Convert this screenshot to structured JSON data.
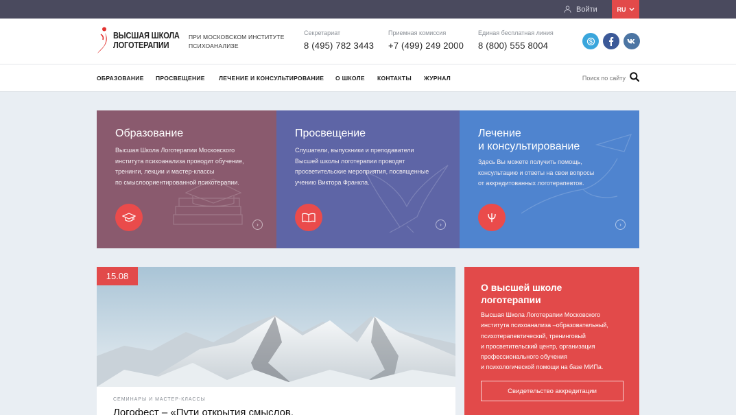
{
  "topbar": {
    "login_label": "Войти",
    "lang_label": "RU"
  },
  "header": {
    "logo_text": "ВЫСШАЯ ШКОЛА ЛОГОТЕРАПИИ",
    "tagline": "ПРИ МОСКОВСКОМ ИНСТИТУТЕ ПСИХОАНАЛИЗЕ",
    "contacts": [
      {
        "label": "Секретариат",
        "number": "8 (495) 782 3443"
      },
      {
        "label": "Приемная комиссия",
        "number": "+7 (499) 249 2000"
      },
      {
        "label": "Единая бесплатная линия",
        "number": "8 (800) 555 8004"
      }
    ],
    "social": [
      {
        "icon": "skype-icon",
        "color": "#3aa6dc"
      },
      {
        "icon": "facebook-icon",
        "color": "#3b5998"
      },
      {
        "icon": "vk-icon",
        "color": "#4c75a3"
      }
    ]
  },
  "nav": {
    "items": [
      "ОБРАЗОВАНИЕ",
      "ПРОСВЕЩЕНИЕ",
      "ЛЕЧЕНИЕ И КОНСУЛЬТИРОВАНИЕ",
      "О ШКОЛЕ",
      "КОНТАКТЫ",
      "ЖУРНАЛ"
    ],
    "search_placeholder": "Поиск по сайту"
  },
  "cards": [
    {
      "title": "Образование",
      "text": [
        "Высшая Школа Логотерапии Московского",
        "института психоанализа проводит обучение,",
        "тренинги, лекции и мастер-классы",
        "по смыслоориентированной психотерапии."
      ],
      "color": "#8a5a6e",
      "icon": "graduation-cap-icon"
    },
    {
      "title": "Просвещение",
      "text": [
        "Слушатели, выпускники и преподаватели",
        "Высшей школы логотерапии проводят",
        "просветительские мероприятия, посвященные",
        "учению Виктора Франкла."
      ],
      "color": "#5e65a6",
      "icon": "open-book-icon"
    },
    {
      "title": "Лечение\nи консультирование",
      "title_lines": [
        "Лечение",
        "и консультирование"
      ],
      "text": [
        "Здесь Вы можете получить помощь,",
        "консультацию и ответы на свои вопросы",
        "от аккредитованных логотерапевтов."
      ],
      "color": "#4f84cf",
      "icon": "psi-icon"
    }
  ],
  "news": {
    "date": "15.08",
    "category": "СЕМИНАРЫ И МАСТЕР-КЛАССЫ",
    "title": "Логофест – «Пути открытия смыслов."
  },
  "about": {
    "title_lines": [
      "О высшей школе",
      "логотерапии"
    ],
    "text_lines": [
      "Высшая Школа Логотерапии Московского",
      "института психоанализа –образовательный,",
      "психотерапевтический, тренинговый",
      "и просветительский центр, организация",
      "профессионального обучения",
      "и психологической помощи на базе МИПа."
    ],
    "button": "Свидетельство аккредитации"
  },
  "colors": {
    "accent": "#e24a4a",
    "topbar": "#4a4a5e"
  }
}
